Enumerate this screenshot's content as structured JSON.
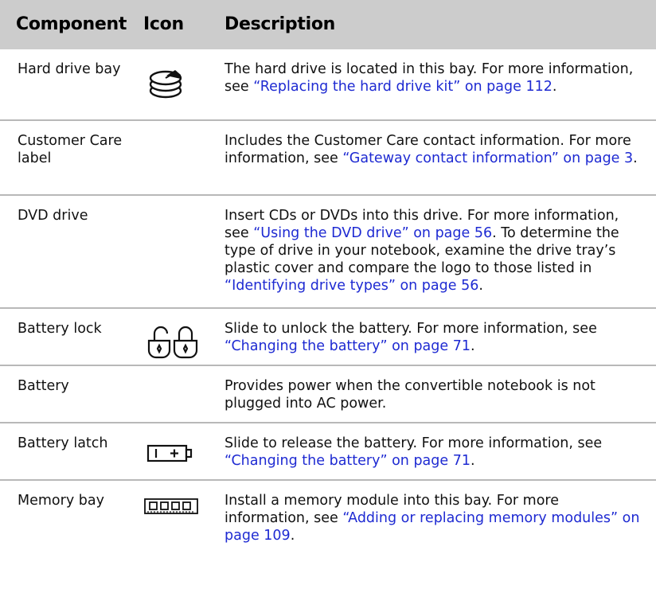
{
  "header": {
    "component": "Component",
    "icon": "Icon",
    "description": "Description"
  },
  "rows": [
    {
      "component": "Hard drive bay",
      "icon": "hard-drive-icon",
      "desc_text": "The hard drive is located in this bay. For more information, see ",
      "link": "“Replacing the hard drive kit” on page 112",
      "desc_after": "."
    },
    {
      "component": "Customer Care label",
      "icon": "",
      "desc_text": "Includes the Customer Care contact information. For more information, see ",
      "link": "“Gateway contact information” on page 3",
      "desc_after": "."
    },
    {
      "component": "DVD drive",
      "icon": "",
      "desc_text": "Insert CDs or DVDs into this drive. For more information, see ",
      "link": "“Using the DVD drive” on page 56",
      "desc_mid": ". To determine the type of drive in your notebook, examine the drive tray’s plastic cover and compare the logo to those listed in ",
      "link2": "“Identifying drive types” on page 56",
      "desc_after": "."
    },
    {
      "component": "Battery lock",
      "icon": "battery-lock-icon",
      "desc_text": "Slide to unlock the battery. For more information, see ",
      "link": "“Changing the battery” on page 71",
      "desc_after": "."
    },
    {
      "component": "Battery",
      "icon": "",
      "desc_text": "Provides power when the convertible notebook is not plugged into AC power."
    },
    {
      "component": "Battery latch",
      "icon": "battery-icon",
      "desc_text": "Slide to release the battery. For more information, see ",
      "link": "“Changing the battery” on page 71",
      "desc_after": "."
    },
    {
      "component": "Memory bay",
      "icon": "memory-module-icon",
      "desc_text": "Install a memory module into this bay. For more information, see ",
      "link": "“Adding or replacing memory modules” on page 109",
      "desc_after": "."
    }
  ]
}
